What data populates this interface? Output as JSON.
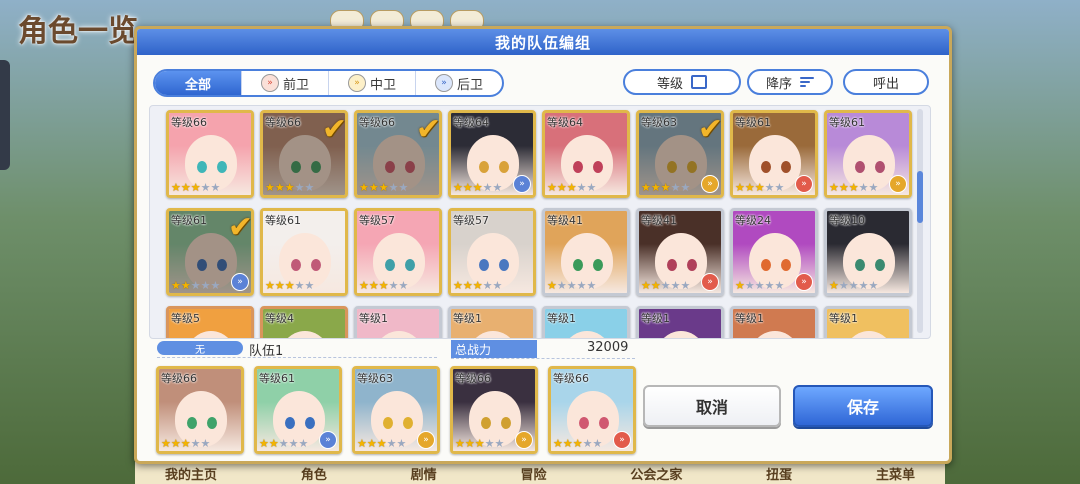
{
  "background": {
    "title": "角色一览",
    "bottom_nav": [
      "我的主页",
      "角色",
      "剧情",
      "冒险",
      "公会之家",
      "扭蛋",
      "主菜单"
    ]
  },
  "modal": {
    "title": "我的队伍编组",
    "filters": [
      {
        "label": "全部",
        "icon": "",
        "active": true
      },
      {
        "label": "前卫",
        "icon": "front-position-icon",
        "active": false
      },
      {
        "label": "中卫",
        "icon": "middle-position-icon",
        "active": false
      },
      {
        "label": "后卫",
        "icon": "back-position-icon",
        "active": false
      }
    ],
    "sort_level_label": "等级",
    "sort_order_label": "降序",
    "call_label": "呼出",
    "level_prefix": "等级",
    "characters": [
      {
        "level": "66",
        "stars": 3,
        "role": "",
        "frame": "gold",
        "selected": false,
        "hair": "#f5a3ad",
        "eye": "#3fb6b8"
      },
      {
        "level": "66",
        "stars": 3,
        "role": "",
        "frame": "gold",
        "selected": true,
        "hair": "#c08f7a",
        "eye": "#3ea36a"
      },
      {
        "level": "66",
        "stars": 3,
        "role": "",
        "frame": "gold",
        "selected": true,
        "hair": "#a9d5ea",
        "eye": "#d05870"
      },
      {
        "level": "64",
        "stars": 3,
        "role": "back",
        "frame": "gold",
        "selected": false,
        "hair": "#2c2c36",
        "eye": "#d9a23a"
      },
      {
        "level": "64",
        "stars": 3,
        "role": "",
        "frame": "gold",
        "selected": false,
        "hair": "#d8707a",
        "eye": "#c0405a"
      },
      {
        "level": "63",
        "stars": 3,
        "role": "mid",
        "frame": "gold",
        "selected": true,
        "hair": "#8fb4cc",
        "eye": "#e0b030"
      },
      {
        "level": "61",
        "stars": 3,
        "role": "front",
        "frame": "gold",
        "selected": false,
        "hair": "#9a6a3a",
        "eye": "#a0502a"
      },
      {
        "level": "61",
        "stars": 3,
        "role": "mid",
        "frame": "gold",
        "selected": false,
        "hair": "#b88ad8",
        "eye": "#b05070"
      },
      {
        "level": "61",
        "stars": 2,
        "role": "back",
        "frame": "gold",
        "selected": true,
        "hair": "#8fd0a8",
        "eye": "#3a70c0"
      },
      {
        "level": "61",
        "stars": 3,
        "role": "",
        "frame": "gold",
        "selected": false,
        "hair": "#f3efec",
        "eye": "#c05a78"
      },
      {
        "level": "57",
        "stars": 3,
        "role": "",
        "frame": "gold",
        "selected": false,
        "hair": "#f5a6b4",
        "eye": "#3fa0a8"
      },
      {
        "level": "57",
        "stars": 3,
        "role": "",
        "frame": "gold",
        "selected": false,
        "hair": "#d8d2cc",
        "eye": "#4a78c0"
      },
      {
        "level": "41",
        "stars": 1,
        "role": "",
        "frame": "silver",
        "selected": false,
        "hair": "#e0a45a",
        "eye": "#3a9a5a"
      },
      {
        "level": "41",
        "stars": 2,
        "role": "front",
        "frame": "silver",
        "selected": false,
        "hair": "#4a3028",
        "eye": "#b0405a"
      },
      {
        "level": "24",
        "stars": 1,
        "role": "front",
        "frame": "silver",
        "selected": false,
        "hair": "#b04ac0",
        "eye": "#e06a30"
      },
      {
        "level": "10",
        "stars": 1,
        "role": "",
        "frame": "silver",
        "selected": false,
        "hair": "#2a2a32",
        "eye": "#3a8a70"
      },
      {
        "level": "5",
        "stars": 1,
        "role": "",
        "frame": "bronze",
        "selected": false,
        "hair": "#f0a040",
        "eye": "#3a6ac0"
      },
      {
        "level": "4",
        "stars": 1,
        "role": "",
        "frame": "bronze",
        "selected": false,
        "hair": "#8aa84a",
        "eye": "#3a6ac0"
      },
      {
        "level": "1",
        "stars": 1,
        "role": "",
        "frame": "silver",
        "selected": false,
        "hair": "#f0b8c8",
        "eye": "#3a6ac0"
      },
      {
        "level": "1",
        "stars": 1,
        "role": "",
        "frame": "silver",
        "selected": false,
        "hair": "#e8b070",
        "eye": "#3a6ac0"
      },
      {
        "level": "1",
        "stars": 1,
        "role": "",
        "frame": "silver",
        "selected": false,
        "hair": "#8ad0e8",
        "eye": "#3a6ac0"
      },
      {
        "level": "1",
        "stars": 1,
        "role": "",
        "frame": "silver",
        "selected": false,
        "hair": "#6a3a8a",
        "eye": "#3a6ac0"
      },
      {
        "level": "1",
        "stars": 1,
        "role": "",
        "frame": "silver",
        "selected": false,
        "hair": "#d07a50",
        "eye": "#3a6ac0"
      },
      {
        "level": "1",
        "stars": 1,
        "role": "",
        "frame": "silver",
        "selected": false,
        "hair": "#f0c060",
        "eye": "#3a6ac0"
      }
    ],
    "team": {
      "badge": "无",
      "name": "队伍1",
      "power_label": "总战力",
      "power_value": "32009",
      "members": [
        {
          "level": "66",
          "stars": 3,
          "role": "",
          "hair": "#c08f7a",
          "eye": "#3ea36a"
        },
        {
          "level": "61",
          "stars": 2,
          "role": "back",
          "hair": "#8fd0a8",
          "eye": "#3a70c0"
        },
        {
          "level": "63",
          "stars": 3,
          "role": "mid",
          "hair": "#8fb4cc",
          "eye": "#e0b030"
        },
        {
          "level": "66",
          "stars": 3,
          "role": "mid",
          "hair": "#3a3040",
          "eye": "#d0a030"
        },
        {
          "level": "66",
          "stars": 3,
          "role": "front",
          "hair": "#a9d5ea",
          "eye": "#d05870"
        }
      ]
    },
    "cancel_label": "取消",
    "save_label": "保存"
  }
}
